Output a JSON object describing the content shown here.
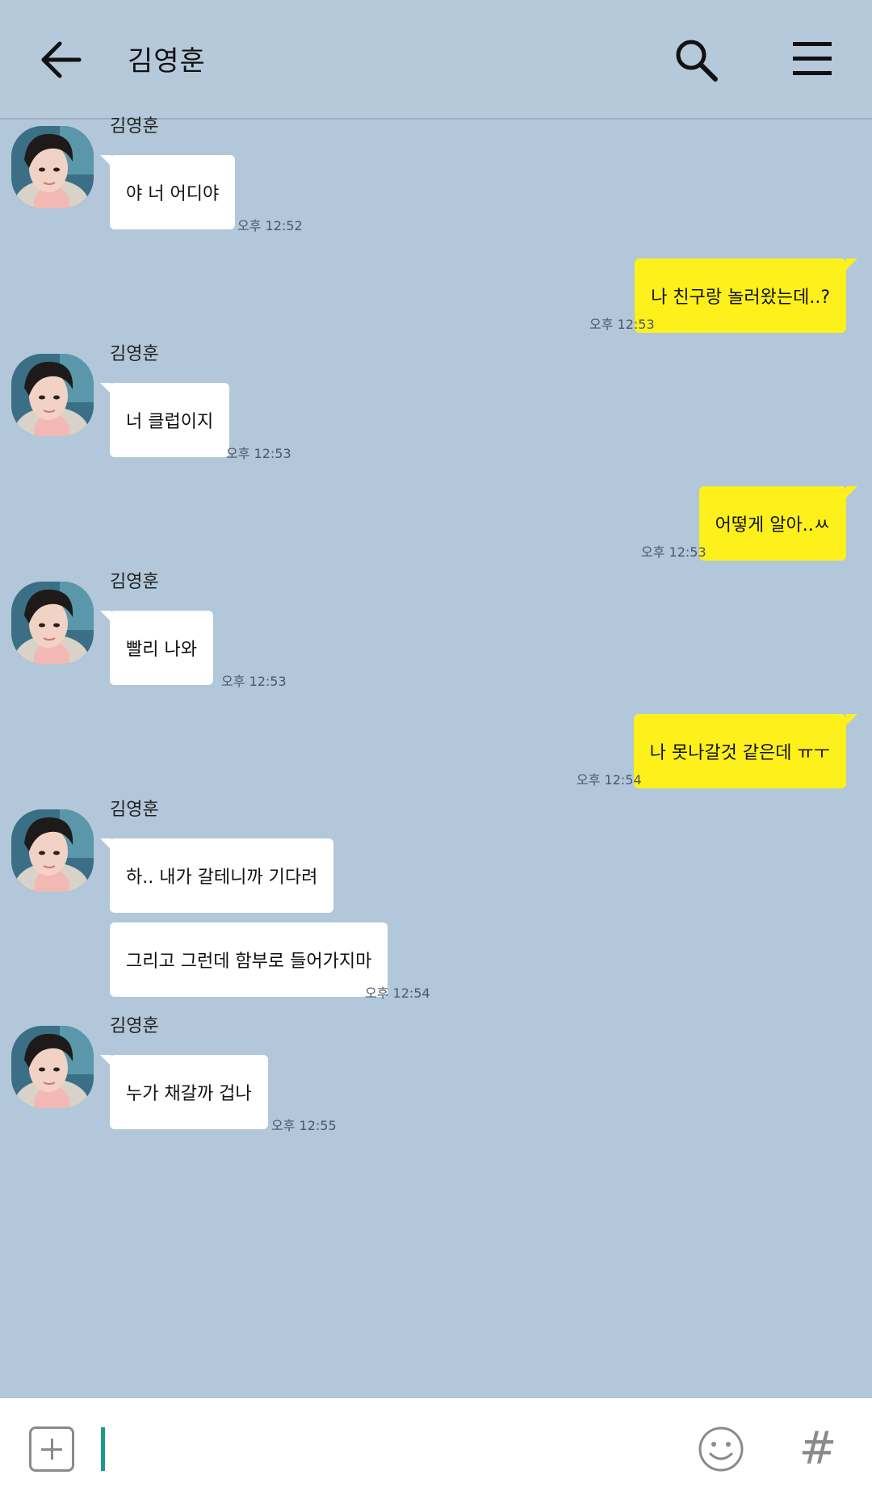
{
  "header": {
    "title": "김영훈",
    "back_icon": "arrow-left-icon",
    "search_icon": "search-icon",
    "menu_icon": "hamburger-menu-icon"
  },
  "messages": [
    {
      "direction": "in",
      "sender": "김영훈",
      "text": "야 너 어디야",
      "time": "오후 12:52"
    },
    {
      "direction": "out",
      "text": "나 친구랑 놀러왔는데..?",
      "time": "오후 12:53"
    },
    {
      "direction": "in",
      "sender": "김영훈",
      "text": "너 클럽이지",
      "time": "오후 12:53"
    },
    {
      "direction": "out",
      "text": "어떻게 알아..ㅆ",
      "time": "오후 12:53"
    },
    {
      "direction": "in",
      "sender": "김영훈",
      "text": "빨리 나와",
      "time": "오후 12:53"
    },
    {
      "direction": "out",
      "text": "나 못나갈것 같은데 ㅠㅜ",
      "time": "오후 12:54"
    },
    {
      "direction": "in",
      "sender": "김영훈",
      "text": "하.. 내가 갈테니까 기다려"
    },
    {
      "direction": "in",
      "text": "그리고 그런데 함부로 들어가지마",
      "time": "오후 12:54"
    },
    {
      "direction": "in",
      "sender": "김영훈",
      "text": "누가 채갈까 겁나",
      "time": "오후 12:55"
    }
  ],
  "input": {
    "value": "",
    "plus_icon": "plus-square-icon",
    "emoji_icon": "smiley-icon",
    "hash_icon": "hashtag-icon",
    "hash_label": "#"
  },
  "colors": {
    "background": "#b2c7da",
    "incoming_bubble": "#ffffff",
    "outgoing_bubble": "#fef01b",
    "caret": "#1a9a8c"
  }
}
